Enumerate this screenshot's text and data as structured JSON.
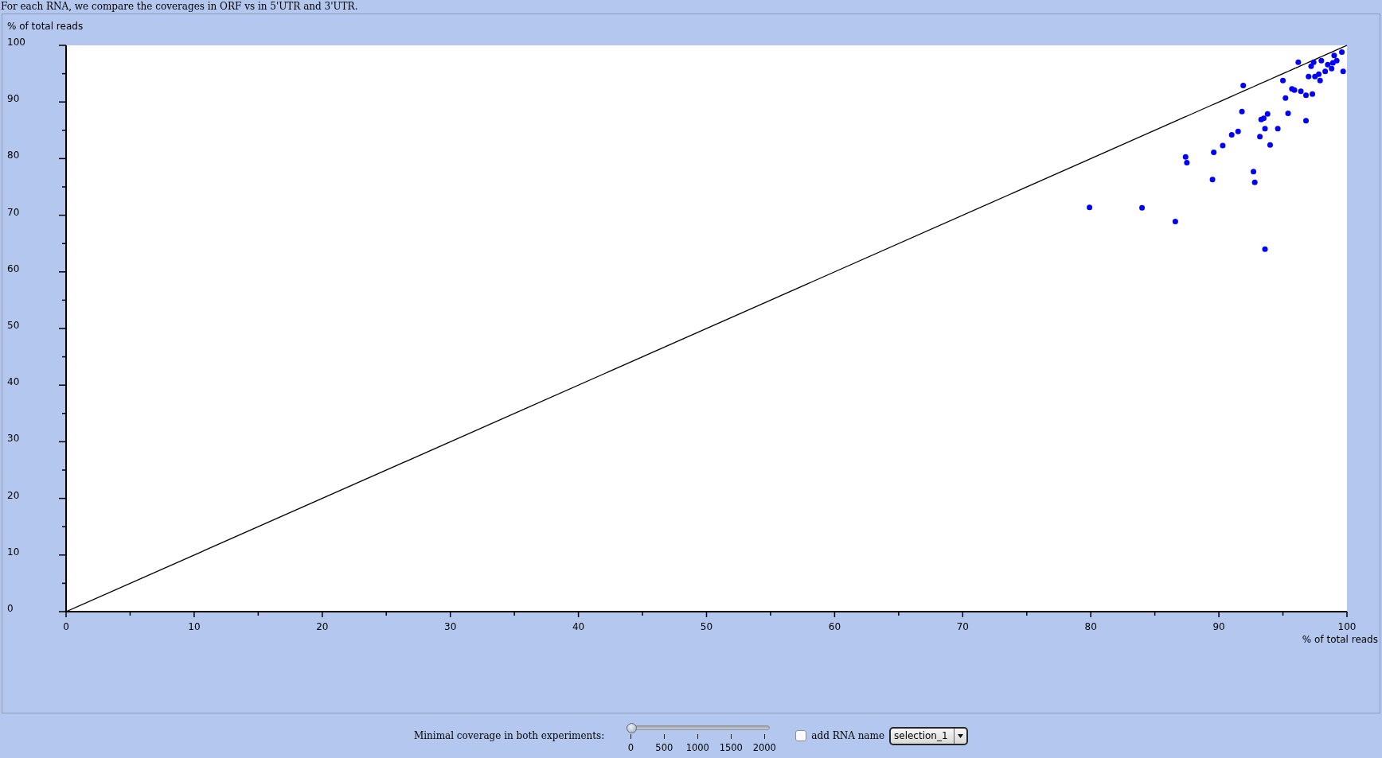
{
  "description": "For each RNA, we compare the coverages in ORF vs in 5'UTR and 3'UTR.",
  "chart": {
    "chart_data": {
      "type": "scatter",
      "xlabel": "% of total reads",
      "ylabel": "% of total reads",
      "xlim": [
        0,
        100
      ],
      "ylim": [
        0,
        100
      ],
      "xticks": [
        0,
        10,
        20,
        30,
        40,
        50,
        60,
        70,
        80,
        90,
        100
      ],
      "yticks": [
        0,
        10,
        20,
        30,
        40,
        50,
        60,
        70,
        80,
        90,
        100
      ],
      "x": [
        0,
        79.9,
        84.0,
        86.6,
        87.4,
        87.5,
        89.5,
        89.6,
        90.3,
        91.0,
        91.5,
        91.8,
        91.9,
        92.7,
        92.8,
        93.2,
        93.3,
        93.5,
        93.6,
        93.6,
        93.8,
        94.0,
        94.6,
        95.0,
        95.2,
        95.4,
        95.7,
        95.9,
        96.2,
        96.4,
        96.8,
        96.8,
        97.0,
        97.2,
        97.3,
        97.4,
        97.5,
        97.8,
        97.9,
        98.0,
        98.3,
        98.5,
        98.8,
        98.9,
        99.0,
        99.2,
        99.6,
        99.7,
        100
      ],
      "series": [
        {
          "type": "scatter",
          "color": "#0000ff",
          "values": [
            null,
            71.4,
            71.3,
            68.9,
            80.3,
            79.3,
            76.3,
            81.1,
            82.3,
            84.2,
            84.8,
            88.3,
            92.9,
            77.7,
            75.8,
            83.9,
            86.9,
            87.1,
            85.3,
            64.0,
            87.9,
            82.4,
            85.3,
            93.8,
            90.7,
            88.0,
            92.3,
            92.1,
            97.0,
            91.9,
            91.2,
            86.7,
            94.5,
            96.3,
            91.4,
            97.0,
            94.5,
            94.9,
            93.8,
            97.3,
            95.4,
            96.6,
            95.9,
            96.9,
            98.2,
            97.3,
            98.8,
            95.4,
            null
          ]
        },
        {
          "type": "line",
          "color": "#000000",
          "values": [
            0,
            79.9,
            84.0,
            86.6,
            87.4,
            87.5,
            89.5,
            89.6,
            90.3,
            91.0,
            91.5,
            91.8,
            91.9,
            92.7,
            92.8,
            93.2,
            93.3,
            93.5,
            93.6,
            93.6,
            93.8,
            94.0,
            94.6,
            95.0,
            95.2,
            95.4,
            95.7,
            95.9,
            96.2,
            96.4,
            96.8,
            96.8,
            97.0,
            97.2,
            97.3,
            97.4,
            97.5,
            97.8,
            97.9,
            98.0,
            98.3,
            98.5,
            98.8,
            98.9,
            99.0,
            99.2,
            99.6,
            99.7,
            100
          ]
        }
      ]
    }
  },
  "controls": {
    "coverage_label": "Minimal coverage in both experiments:",
    "coverage_slider": {
      "level": 0,
      "ticks": [
        "0",
        "500",
        "1000",
        "1500",
        "2000"
      ]
    },
    "rna_name_checkbox": {
      "label": "add RNA name",
      "checked": false
    },
    "selection_select": {
      "value": "selection_1"
    }
  }
}
